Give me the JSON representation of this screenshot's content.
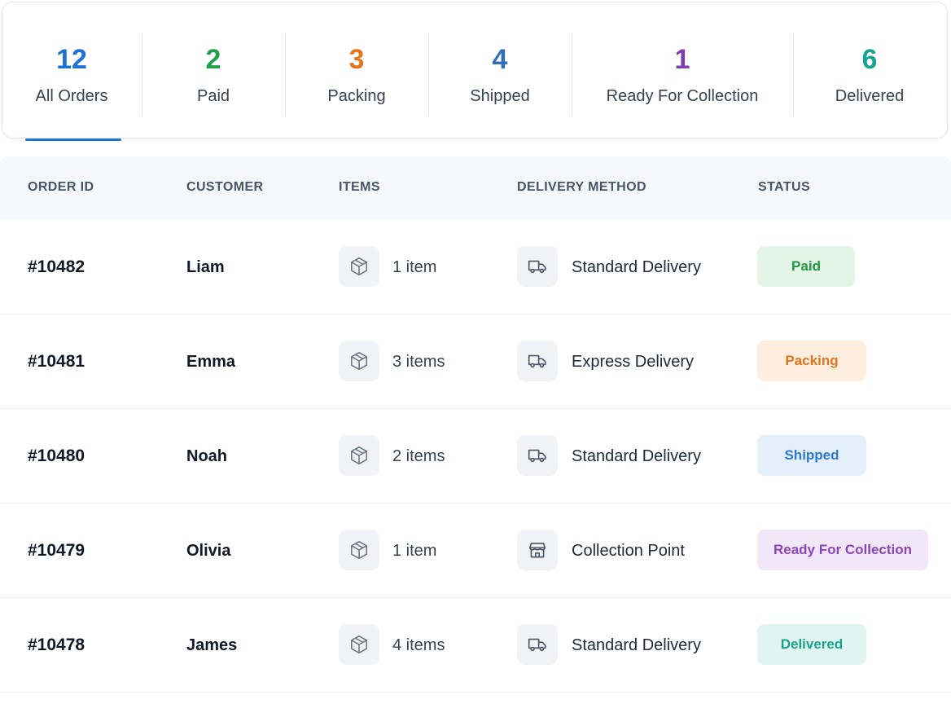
{
  "summary": {
    "tabs": [
      {
        "count": "12",
        "label": "All Orders",
        "color": "#1d72d8",
        "active": true
      },
      {
        "count": "2",
        "label": "Paid",
        "color": "#22a14a"
      },
      {
        "count": "3",
        "label": "Packing",
        "color": "#e6761c"
      },
      {
        "count": "4",
        "label": "Shipped",
        "color": "#2f6fb8"
      },
      {
        "count": "1",
        "label": "Ready For Collection",
        "color": "#7e3fb3"
      },
      {
        "count": "6",
        "label": "Delivered",
        "color": "#16a392"
      }
    ]
  },
  "table": {
    "headers": {
      "order_id": "ORDER ID",
      "customer": "CUSTOMER",
      "items": "ITEMS",
      "delivery": "DELIVERY METHOD",
      "status": "STATUS"
    },
    "rows": [
      {
        "order_id": "#10482",
        "customer": "Liam",
        "items": "1 item",
        "delivery": "Standard Delivery",
        "delivery_icon": "truck-icon",
        "status": "Paid"
      },
      {
        "order_id": "#10481",
        "customer": "Emma",
        "items": "3 items",
        "delivery": "Express Delivery",
        "delivery_icon": "truck-icon",
        "status": "Packing"
      },
      {
        "order_id": "#10480",
        "customer": "Noah",
        "items": "2 items",
        "delivery": "Standard Delivery",
        "delivery_icon": "truck-icon",
        "status": "Shipped"
      },
      {
        "order_id": "#10479",
        "customer": "Olivia",
        "items": "1 item",
        "delivery": "Collection Point",
        "delivery_icon": "store-icon",
        "status": "Ready For Collection"
      },
      {
        "order_id": "#10478",
        "customer": "James",
        "items": "4 items",
        "delivery": "Standard Delivery",
        "delivery_icon": "truck-icon",
        "status": "Delivered"
      }
    ]
  },
  "status_colors": {
    "Paid": {
      "bg": "#e3f5e6",
      "fg": "#23963f"
    },
    "Packing": {
      "bg": "#fdeedf",
      "fg": "#e0731b"
    },
    "Shipped": {
      "bg": "#e4effc",
      "fg": "#2f78d2"
    },
    "Ready For Collection": {
      "bg": "#f2e7f8",
      "fg": "#8a45b8"
    },
    "Delivered": {
      "bg": "#e1f5f0",
      "fg": "#1aa38c"
    }
  }
}
